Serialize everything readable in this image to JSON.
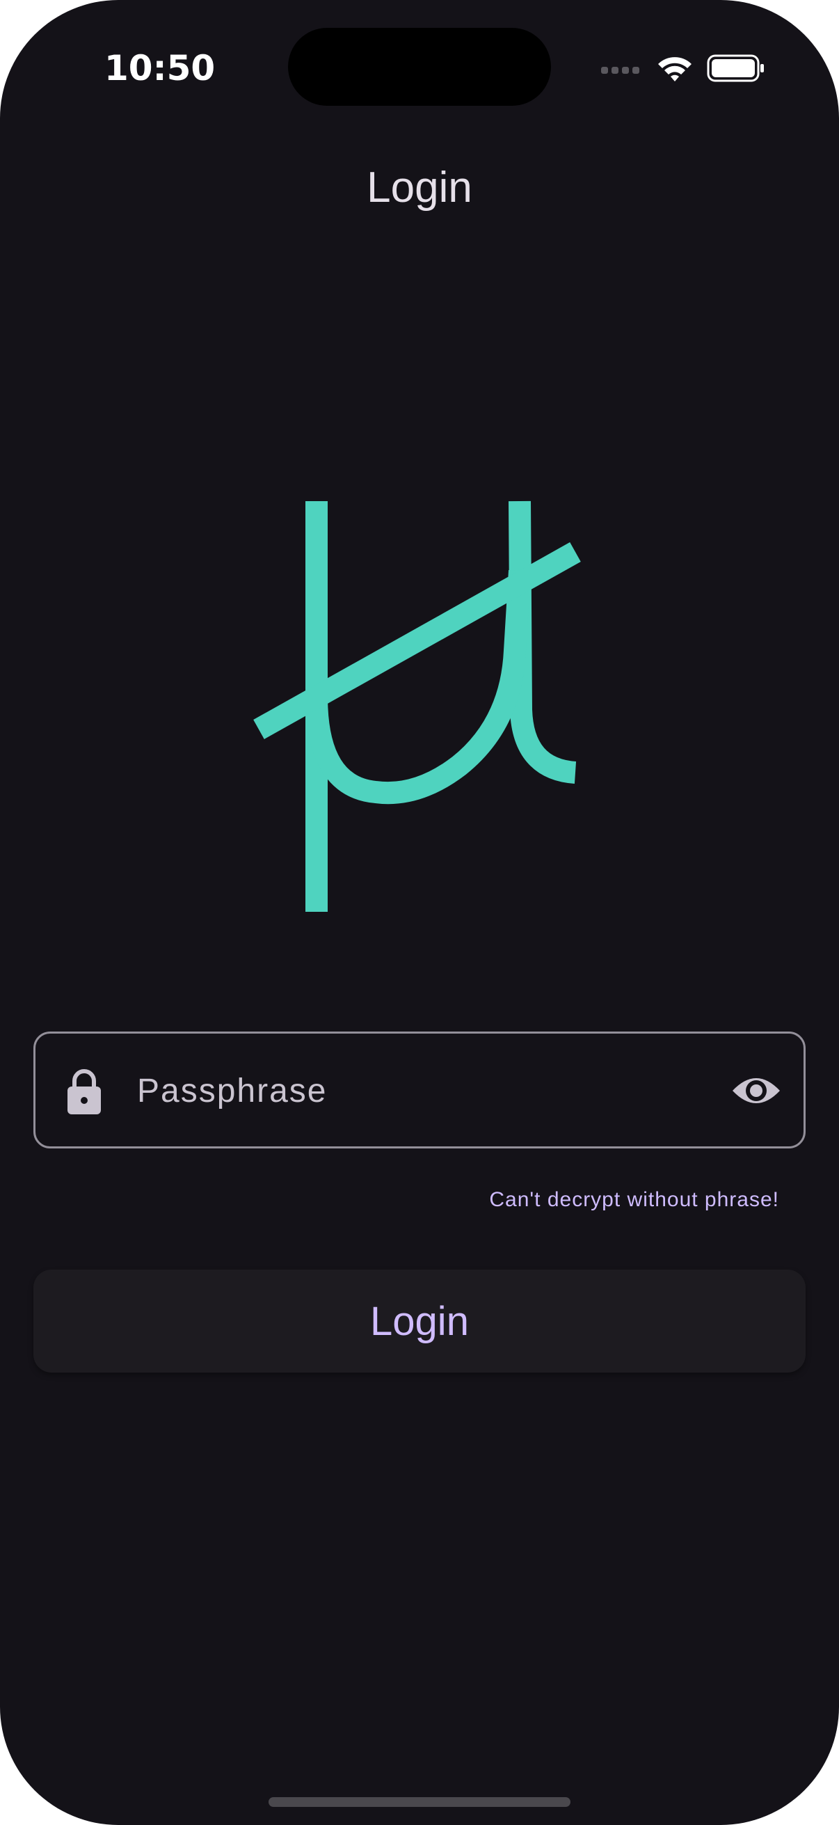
{
  "status_bar": {
    "time": "10:50",
    "icons": [
      "cellular-signal-icon",
      "wifi-icon",
      "battery-icon"
    ]
  },
  "app_bar": {
    "title": "Login"
  },
  "logo": {
    "icon": "app-logo-icon",
    "color": "#4fd3bf"
  },
  "passphrase_field": {
    "value": "",
    "placeholder": "Passphrase",
    "leading_icon": "lock-icon",
    "trailing_icon": "eye-icon",
    "helper_text": "Can't decrypt without phrase!"
  },
  "login_button": {
    "label": "Login"
  },
  "colors": {
    "background": "#141218",
    "accent": "#d0bcff",
    "logo": "#4fd3bf",
    "outline": "#938f99"
  }
}
